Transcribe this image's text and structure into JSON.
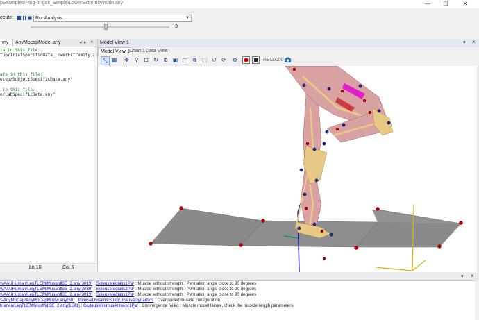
{
  "window": {
    "title": "pExamples\\Plug-in-gait_Simple\\LowerExtremity.main.any",
    "min": "—",
    "max": "☐",
    "close": "✕"
  },
  "runbar": {
    "execute_label": "ecute:",
    "operation_value": "RunAnalysis",
    "slider_value": "3"
  },
  "editor": {
    "tabs": [
      "my",
      "AnyMocapModel.any"
    ],
    "lines": [
      {
        "text": "ta in this file:",
        "kind": "comment"
      },
      {
        "text": "tup/TrialSpecificData_LowerExtremity.any\"",
        "kind": "code"
      },
      {
        "text": "",
        "kind": "code"
      },
      {
        "text": "ata in this file:",
        "kind": "comment"
      },
      {
        "text": "etup/SubjectSpecificData.any\"",
        "kind": "code"
      },
      {
        "text": "",
        "kind": "code"
      },
      {
        "text": " in this file:",
        "kind": "comment"
      },
      {
        "text": "o/LabSpecificData.any\"",
        "kind": "code"
      }
    ],
    "status_line": "Ln 10",
    "status_col": "Col 5"
  },
  "model_view": {
    "title": "Model View 1",
    "tabs": [
      "Model View 1",
      "Chart 1",
      "Data View"
    ],
    "rec_label": "REC",
    "rec_time": "0000"
  },
  "log": {
    "lines": [
      {
        "path": "y/AAUHuman/LegTLEM/MusMdl3E_2.any(3019)",
        "link": "SoleusMedialis1Par",
        "msg": " :  Muscle without strength  :  Pennation angle close to 90 degrees"
      },
      {
        "path": "y/AAUHuman/LegTLEM/MusMdl3E_2.any(3039)",
        "link": "SoleusMedialis2Par",
        "msg": " :  Muscle without strength  :  Pennation angle close to 90 degrees"
      },
      {
        "path": "y/AAUHuman/LegTLEM/MusMdl3E_2.any(3019)",
        "link": "SoleusMedialis1Par",
        "msg": " :  Muscle without strength  :  Pennation angle close to 90 degrees"
      },
      {
        "path": "s/AnyMoCap/AnyMoCapModel.any(60)",
        "link": "InverseDynamicStudy.InverseDynamics",
        "msg": " :  Overloaded muscle configuration."
      },
      {
        "path": "human/LegTLEM/MusMdl3E_2.any(1591)",
        "link": "GluteusMinimusAnterior1Par",
        "msg": " :  Convergence failed  :  Muscle model failure, check the muscle length parameters"
      }
    ]
  },
  "colors": {
    "accent": "#1d4a8a",
    "link": "#1010c8",
    "comment": "#1f8a1f",
    "floor": "#8a8a8a",
    "bone": "#e8c887",
    "muscle": "#d9a1a1"
  }
}
